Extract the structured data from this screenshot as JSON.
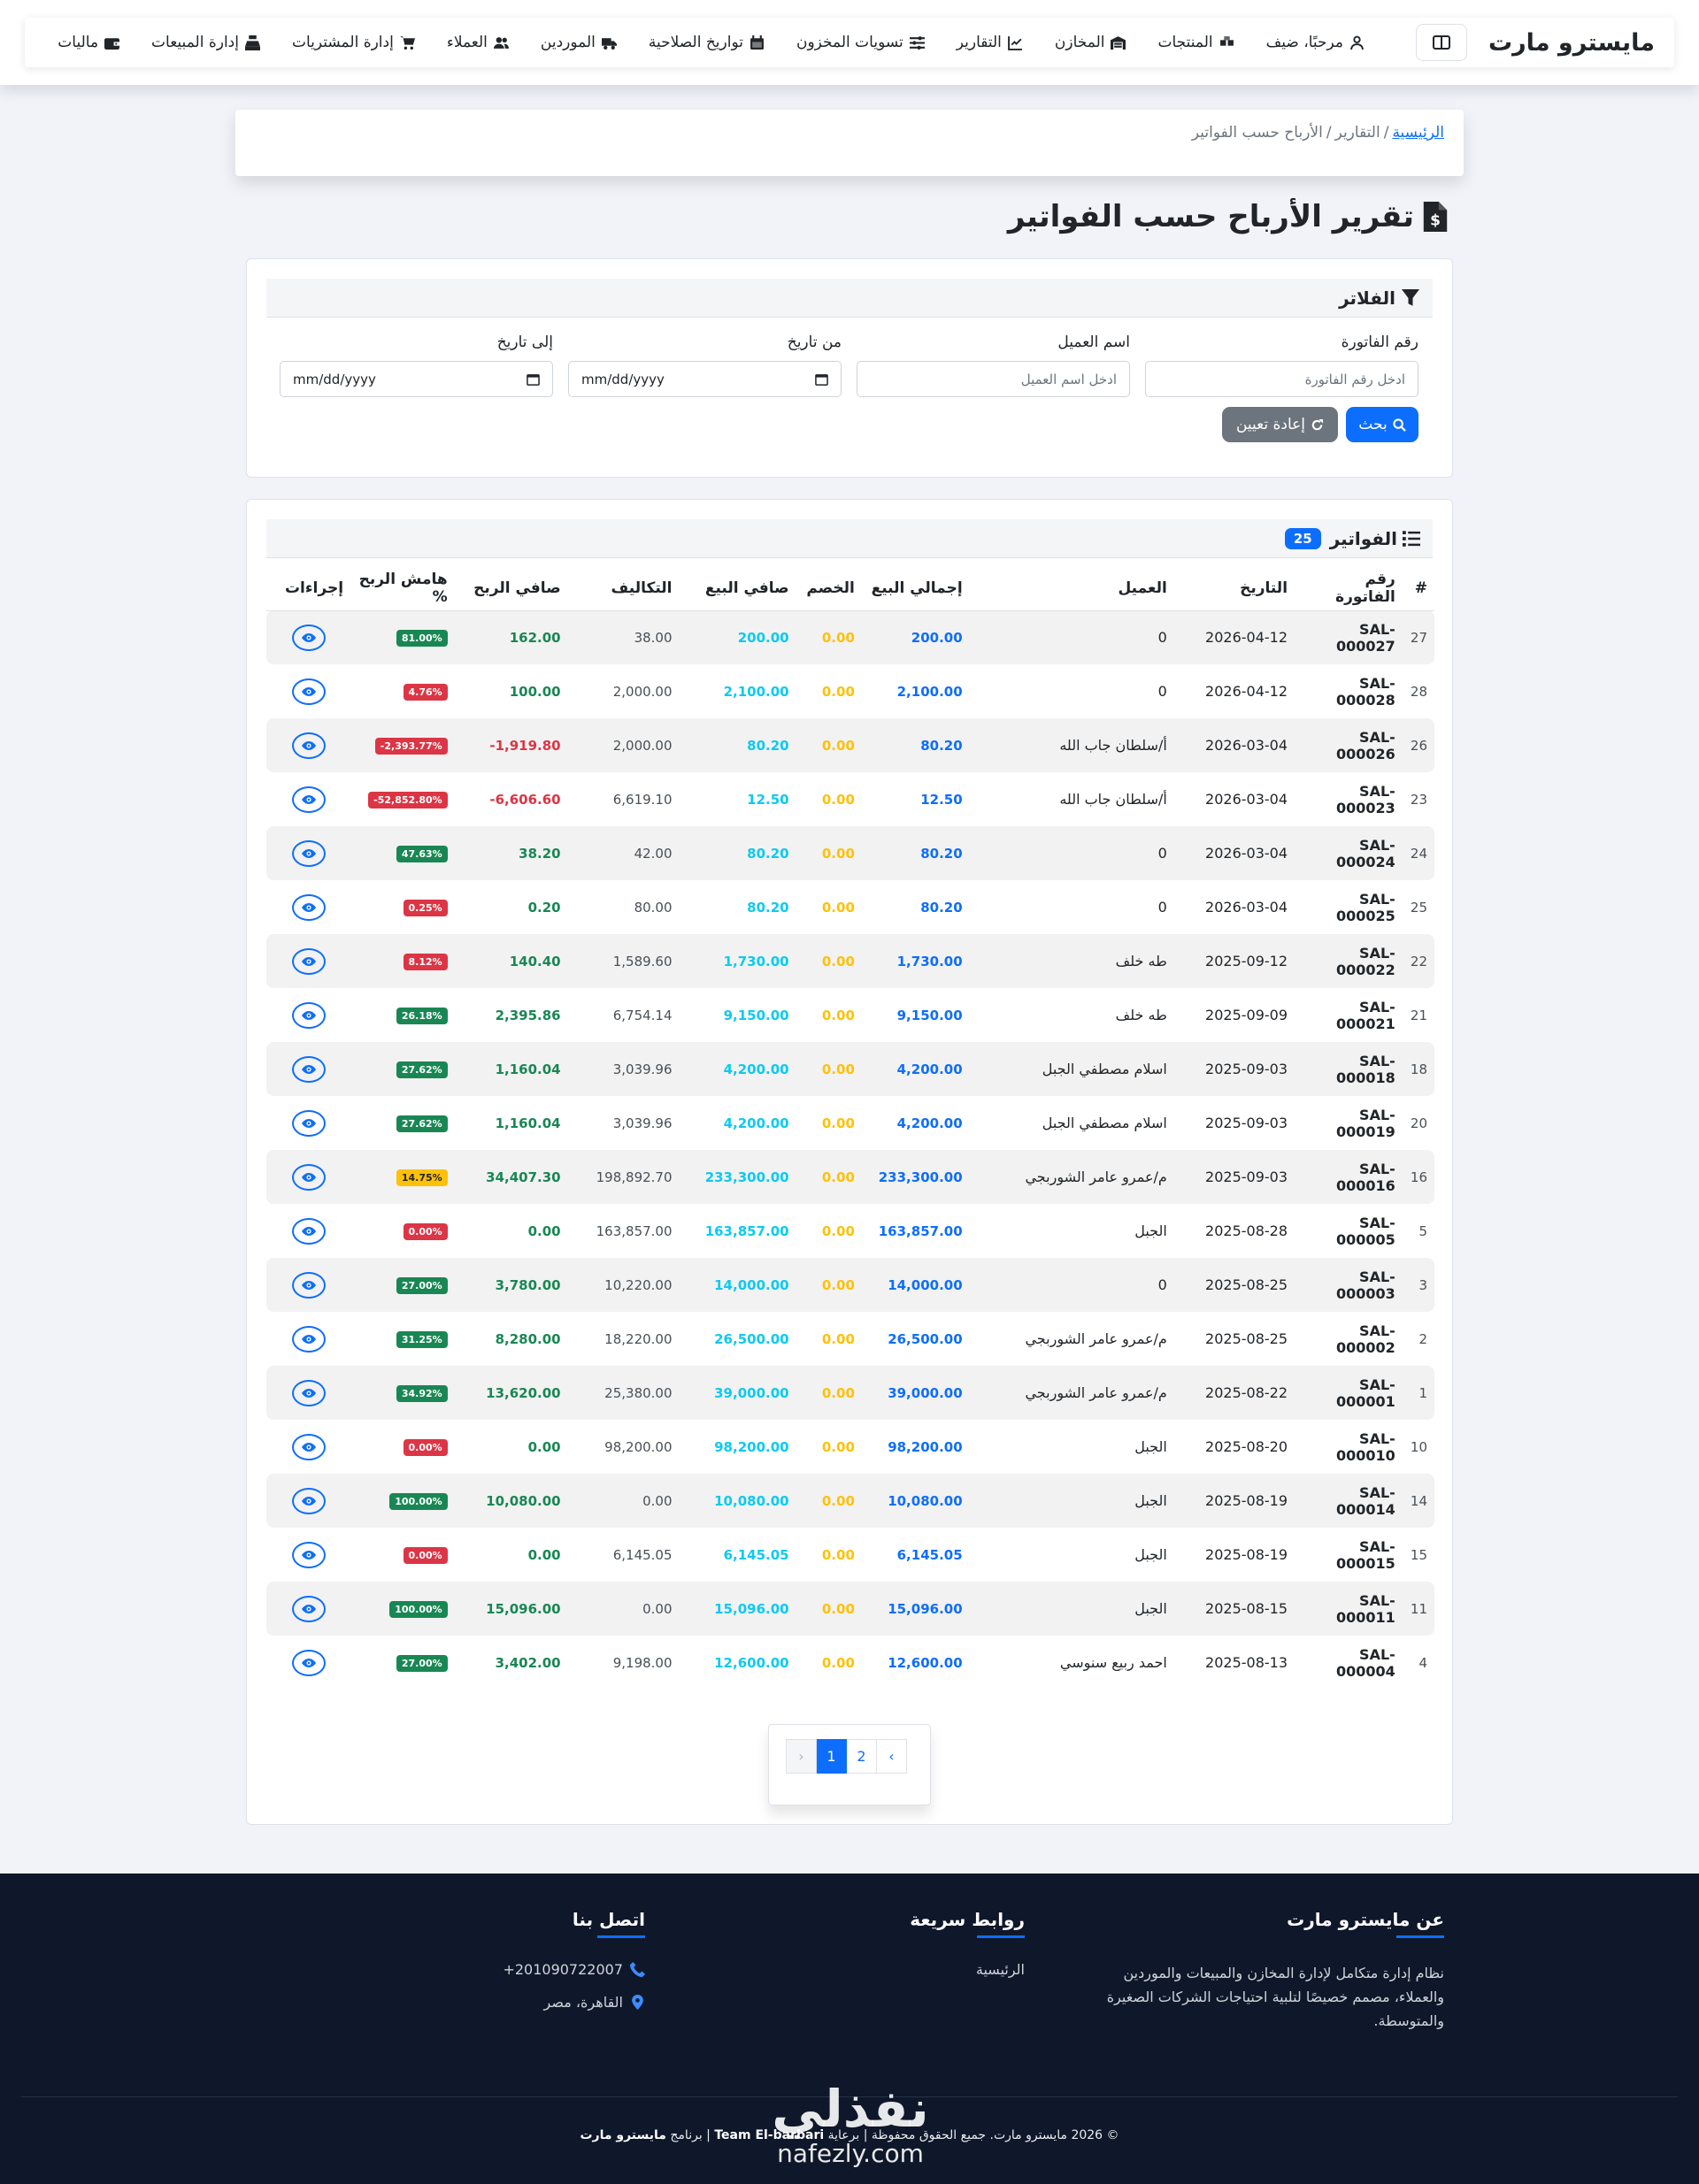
{
  "brand": "مايسترو مارت",
  "nav": [
    {
      "label": "مرحبًا، ضيف",
      "icon": "user-icon"
    },
    {
      "label": "المنتجات",
      "icon": "boxes-icon"
    },
    {
      "label": "المخازن",
      "icon": "warehouse-icon"
    },
    {
      "label": "التقارير",
      "icon": "chart-line-icon"
    },
    {
      "label": "تسويات المخزون",
      "icon": "sliders-icon"
    },
    {
      "label": "تواريخ الصلاحية",
      "icon": "calendar-icon"
    },
    {
      "label": "الموردين",
      "icon": "truck-icon"
    },
    {
      "label": "العملاء",
      "icon": "users-icon"
    },
    {
      "label": "إدارة المشتريات",
      "icon": "cart-icon"
    },
    {
      "label": "إدارة المبيعات",
      "icon": "cash-register-icon"
    },
    {
      "label": "ماليات",
      "icon": "wallet-icon"
    }
  ],
  "breadcrumb": {
    "home": "الرئيسية",
    "reports": "التقارير",
    "current": "الأرباح حسب الفواتير"
  },
  "page_title": "تقرير الأرباح حسب الفواتير",
  "filters": {
    "title": "الفلاتر",
    "invoice_label": "رقم الفاتورة",
    "invoice_placeholder": "ادخل رقم الفاتورة",
    "customer_label": "اسم العميل",
    "customer_placeholder": "ادخل اسم العميل",
    "from_label": "من تاريخ",
    "from_value": "mm/dd/yyyy",
    "to_label": "إلى تاريخ",
    "to_value": "mm/dd/yyyy",
    "search_btn": "بحث",
    "reset_btn": "إعادة تعيين"
  },
  "invoices": {
    "title": "الفواتير",
    "count": "25",
    "columns": [
      "#",
      "رقم الفاتورة",
      "التاريخ",
      "العميل",
      "إجمالي البيع",
      "الخصم",
      "صافي البيع",
      "التكاليف",
      "صافي الربح",
      "هامش الربح %",
      "إجراءات"
    ],
    "rows": [
      {
        "n": "27",
        "inv": "SAL-000027",
        "date": "2026-04-12",
        "customer": "0",
        "total": "200.00",
        "disc": "0.00",
        "net": "200.00",
        "cost": "38.00",
        "profit": "162.00",
        "margin": "81.00%",
        "mc": "green",
        "pc": "green"
      },
      {
        "n": "28",
        "inv": "SAL-000028",
        "date": "2026-04-12",
        "customer": "0",
        "total": "2,100.00",
        "disc": "0.00",
        "net": "2,100.00",
        "cost": "2,000.00",
        "profit": "100.00",
        "margin": "4.76%",
        "mc": "red",
        "pc": "green"
      },
      {
        "n": "26",
        "inv": "SAL-000026",
        "date": "2026-03-04",
        "customer": "أ/سلطان جاب الله",
        "total": "80.20",
        "disc": "0.00",
        "net": "80.20",
        "cost": "2,000.00",
        "profit": "-1,919.80",
        "margin": "-2,393.77%",
        "mc": "red",
        "pc": "red"
      },
      {
        "n": "23",
        "inv": "SAL-000023",
        "date": "2026-03-04",
        "customer": "أ/سلطان جاب الله",
        "total": "12.50",
        "disc": "0.00",
        "net": "12.50",
        "cost": "6,619.10",
        "profit": "-6,606.60",
        "margin": "-52,852.80%",
        "mc": "red",
        "pc": "red"
      },
      {
        "n": "24",
        "inv": "SAL-000024",
        "date": "2026-03-04",
        "customer": "0",
        "total": "80.20",
        "disc": "0.00",
        "net": "80.20",
        "cost": "42.00",
        "profit": "38.20",
        "margin": "47.63%",
        "mc": "green",
        "pc": "green"
      },
      {
        "n": "25",
        "inv": "SAL-000025",
        "date": "2026-03-04",
        "customer": "0",
        "total": "80.20",
        "disc": "0.00",
        "net": "80.20",
        "cost": "80.00",
        "profit": "0.20",
        "margin": "0.25%",
        "mc": "red",
        "pc": "green"
      },
      {
        "n": "22",
        "inv": "SAL-000022",
        "date": "2025-09-12",
        "customer": "طه خلف",
        "total": "1,730.00",
        "disc": "0.00",
        "net": "1,730.00",
        "cost": "1,589.60",
        "profit": "140.40",
        "margin": "8.12%",
        "mc": "red",
        "pc": "green"
      },
      {
        "n": "21",
        "inv": "SAL-000021",
        "date": "2025-09-09",
        "customer": "طه خلف",
        "total": "9,150.00",
        "disc": "0.00",
        "net": "9,150.00",
        "cost": "6,754.14",
        "profit": "2,395.86",
        "margin": "26.18%",
        "mc": "green",
        "pc": "green"
      },
      {
        "n": "18",
        "inv": "SAL-000018",
        "date": "2025-09-03",
        "customer": "اسلام مصطفي الجبل",
        "total": "4,200.00",
        "disc": "0.00",
        "net": "4,200.00",
        "cost": "3,039.96",
        "profit": "1,160.04",
        "margin": "27.62%",
        "mc": "green",
        "pc": "green"
      },
      {
        "n": "20",
        "inv": "SAL-000019",
        "date": "2025-09-03",
        "customer": "اسلام مصطفي الجبل",
        "total": "4,200.00",
        "disc": "0.00",
        "net": "4,200.00",
        "cost": "3,039.96",
        "profit": "1,160.04",
        "margin": "27.62%",
        "mc": "green",
        "pc": "green"
      },
      {
        "n": "16",
        "inv": "SAL-000016",
        "date": "2025-09-03",
        "customer": "م/عمرو عامر الشوربجي",
        "total": "233,300.00",
        "disc": "0.00",
        "net": "233,300.00",
        "cost": "198,892.70",
        "profit": "34,407.30",
        "margin": "14.75%",
        "mc": "yellow",
        "pc": "green"
      },
      {
        "n": "5",
        "inv": "SAL-000005",
        "date": "2025-08-28",
        "customer": "الجبل",
        "total": "163,857.00",
        "disc": "0.00",
        "net": "163,857.00",
        "cost": "163,857.00",
        "profit": "0.00",
        "margin": "0.00%",
        "mc": "red",
        "pc": "green"
      },
      {
        "n": "3",
        "inv": "SAL-000003",
        "date": "2025-08-25",
        "customer": "0",
        "total": "14,000.00",
        "disc": "0.00",
        "net": "14,000.00",
        "cost": "10,220.00",
        "profit": "3,780.00",
        "margin": "27.00%",
        "mc": "green",
        "pc": "green"
      },
      {
        "n": "2",
        "inv": "SAL-000002",
        "date": "2025-08-25",
        "customer": "م/عمرو عامر الشوربجي",
        "total": "26,500.00",
        "disc": "0.00",
        "net": "26,500.00",
        "cost": "18,220.00",
        "profit": "8,280.00",
        "margin": "31.25%",
        "mc": "green",
        "pc": "green"
      },
      {
        "n": "1",
        "inv": "SAL-000001",
        "date": "2025-08-22",
        "customer": "م/عمرو عامر الشوربجي",
        "total": "39,000.00",
        "disc": "0.00",
        "net": "39,000.00",
        "cost": "25,380.00",
        "profit": "13,620.00",
        "margin": "34.92%",
        "mc": "green",
        "pc": "green"
      },
      {
        "n": "10",
        "inv": "SAL-000010",
        "date": "2025-08-20",
        "customer": "الجبل",
        "total": "98,200.00",
        "disc": "0.00",
        "net": "98,200.00",
        "cost": "98,200.00",
        "profit": "0.00",
        "margin": "0.00%",
        "mc": "red",
        "pc": "green"
      },
      {
        "n": "14",
        "inv": "SAL-000014",
        "date": "2025-08-19",
        "customer": "الجبل",
        "total": "10,080.00",
        "disc": "0.00",
        "net": "10,080.00",
        "cost": "0.00",
        "profit": "10,080.00",
        "margin": "100.00%",
        "mc": "green",
        "pc": "green"
      },
      {
        "n": "15",
        "inv": "SAL-000015",
        "date": "2025-08-19",
        "customer": "الجبل",
        "total": "6,145.05",
        "disc": "0.00",
        "net": "6,145.05",
        "cost": "6,145.05",
        "profit": "0.00",
        "margin": "0.00%",
        "mc": "red",
        "pc": "green"
      },
      {
        "n": "11",
        "inv": "SAL-000011",
        "date": "2025-08-15",
        "customer": "الجبل",
        "total": "15,096.00",
        "disc": "0.00",
        "net": "15,096.00",
        "cost": "0.00",
        "profit": "15,096.00",
        "margin": "100.00%",
        "mc": "green",
        "pc": "green"
      },
      {
        "n": "4",
        "inv": "SAL-000004",
        "date": "2025-08-13",
        "customer": "احمد ربيع سنوسي",
        "total": "12,600.00",
        "disc": "0.00",
        "net": "12,600.00",
        "cost": "9,198.00",
        "profit": "3,402.00",
        "margin": "27.00%",
        "mc": "green",
        "pc": "green"
      }
    ]
  },
  "pagination": {
    "prev": "‹",
    "pages": [
      "1",
      "2"
    ],
    "active": "1",
    "next": "›"
  },
  "footer": {
    "about_title": "عن مايسترو مارت",
    "about_text": "نظام إدارة متكامل لإدارة المخازن والمبيعات والموردين والعملاء، مصمم خصيصًا لتلبية احتياجات الشركات الصغيرة والمتوسطة.",
    "links_title": "روابط سريعة",
    "link_home": "الرئيسية",
    "contact_title": "اتصل بنا",
    "phone": "+201090722007",
    "address": "القاهرة، مصر",
    "copyright_pre": "© 2026 مايسترو مارت. جميع الحقوق محفوظة | برعاية",
    "team": "Team El-barbari",
    "copyright_mid": "| برنامج",
    "product": "مايسترو مارت"
  },
  "watermark": {
    "ar": "نفذلي",
    "en": "nafezly.com"
  },
  "colors": {
    "primary": "#0d6efd",
    "secondary": "#6c757d",
    "success": "#198754",
    "danger": "#dc3545",
    "warning": "#ffc107",
    "info": "#0dcaf0",
    "footer_bg": "#0f172a"
  }
}
